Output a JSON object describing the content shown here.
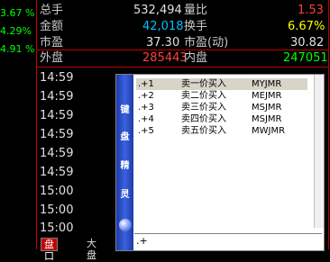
{
  "left_percentages": [
    "3.67 %",
    "4.29%",
    "4.91 %"
  ],
  "stats": [
    {
      "label1": "总手",
      "value1": "532,494",
      "label2": "量比",
      "value2": "1.53"
    },
    {
      "label1": "金额",
      "value1": "42,018",
      "label2": "换手",
      "value2": "6.67%"
    },
    {
      "label1": "市盈",
      "value1": "37.30",
      "label2": "市盈(动)",
      "value2": "30.82"
    },
    {
      "label1": "外盘",
      "value1": "285443",
      "label2": "内盘",
      "value2": "247051"
    }
  ],
  "times": [
    "14:59",
    "14:59",
    "14:59",
    "14:59",
    "14:59",
    "14:59",
    "15:00",
    "15:00",
    "15:00"
  ],
  "tabs": [
    "盘口",
    "大盘"
  ],
  "keyboard_wizard": {
    "side_label": [
      "键",
      "盘",
      "精",
      "灵"
    ],
    "items": [
      {
        "code": ".+1",
        "name": "卖一价买入",
        "abbr": "MYJMR"
      },
      {
        "code": ".+2",
        "name": "卖二价买入",
        "abbr": "MEJMR"
      },
      {
        "code": ".+3",
        "name": "卖三价买入",
        "abbr": "MSJMR"
      },
      {
        "code": ".+4",
        "name": "卖四价买入",
        "abbr": "MSJMR"
      },
      {
        "code": ".+5",
        "name": "卖五价买入",
        "abbr": "MWJMR"
      }
    ],
    "input_value": ".+"
  }
}
